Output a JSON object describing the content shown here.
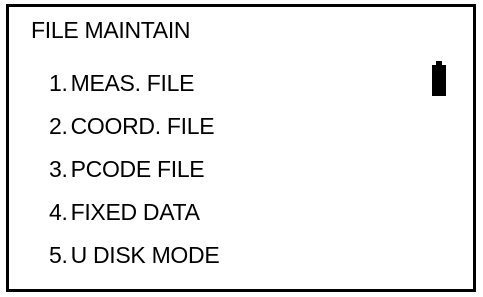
{
  "screen": {
    "title": "FILE MAINTAIN",
    "battery_icon": "battery-full-icon",
    "menu": [
      {
        "num": "1.",
        "label": "MEAS. FILE"
      },
      {
        "num": "2.",
        "label": "COORD. FILE"
      },
      {
        "num": "3.",
        "label": "PCODE FILE"
      },
      {
        "num": "4.",
        "label": "FIXED DATA"
      },
      {
        "num": "5.",
        "label": "U DISK MODE"
      }
    ]
  }
}
